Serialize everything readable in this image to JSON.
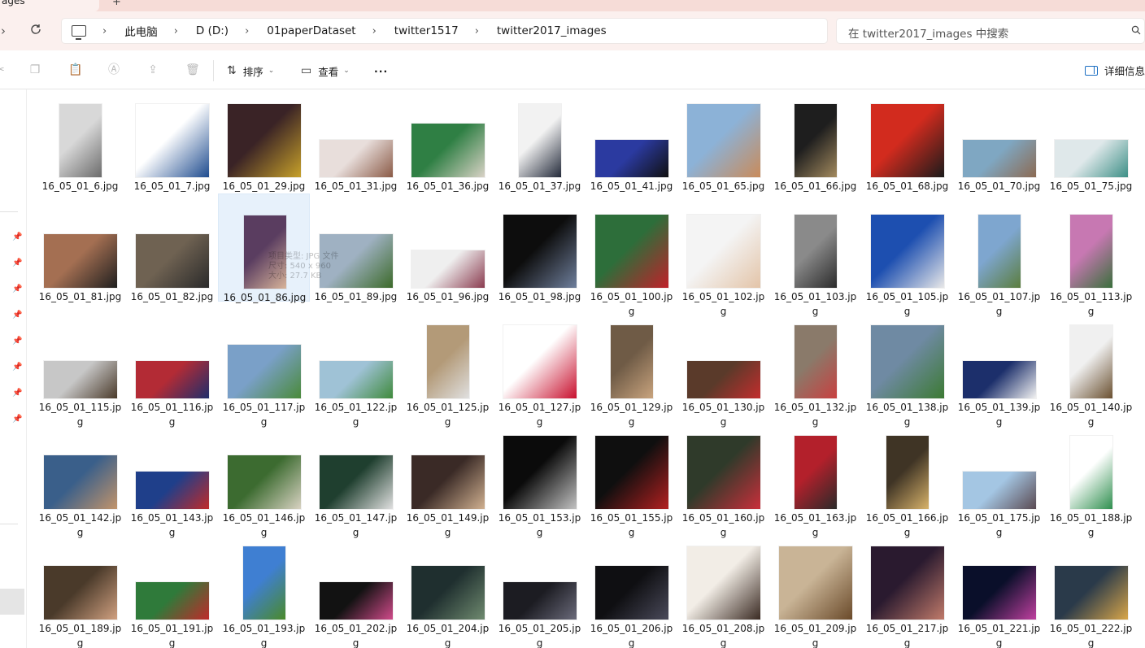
{
  "window": {
    "tab_title": "ages",
    "new_tab_label": "+"
  },
  "addressbar": {
    "crumbs": [
      "此电脑",
      "D (D:)",
      "01paperDataset",
      "twitter1517",
      "twitter2017_images"
    ],
    "separator": "›"
  },
  "search": {
    "placeholder": "在 twitter2017_images 中搜索"
  },
  "toolbar": {
    "sort_label": "排序",
    "view_label": "查看",
    "more_label": "···",
    "details_label": "详细信息"
  },
  "tooltip": {
    "line1": "项目类型: JPG 文件",
    "line2": "尺寸: 540 x 960",
    "line3": "大小: 27.7 KB"
  },
  "colors": {
    "accent": "#1b6ec2",
    "selection": "#e7f1fb",
    "titlebar": "#fbf0ee"
  },
  "files": [
    {
      "name": "16_05_01_6.jpg",
      "thumb": [
        "#d8d8d8",
        "#6b6b6b"
      ],
      "aspect": "portrait"
    },
    {
      "name": "16_05_01_7.jpg",
      "thumb": [
        "#ffffff",
        "#1f4c8f"
      ],
      "aspect": "square"
    },
    {
      "name": "16_05_01_29.jpg",
      "thumb": [
        "#3a2326",
        "#c7a12a"
      ],
      "aspect": "square"
    },
    {
      "name": "16_05_01_31.jpg",
      "thumb": [
        "#e8dedb",
        "#8a5a46"
      ],
      "aspect": "wide"
    },
    {
      "name": "16_05_01_36.jpg",
      "thumb": [
        "#2f7f44",
        "#d9d2c6"
      ],
      "aspect": "landscape"
    },
    {
      "name": "16_05_01_37.jpg",
      "thumb": [
        "#f2f2f2",
        "#232a3a"
      ],
      "aspect": "portrait"
    },
    {
      "name": "16_05_01_41.jpg",
      "thumb": [
        "#2b3aa0",
        "#101010"
      ],
      "aspect": "wide"
    },
    {
      "name": "16_05_01_65.jpg",
      "thumb": [
        "#8cb2d7",
        "#c98b5a"
      ],
      "aspect": "square"
    },
    {
      "name": "16_05_01_66.jpg",
      "thumb": [
        "#1e1e1e",
        "#a38a5e"
      ],
      "aspect": "portrait"
    },
    {
      "name": "16_05_01_68.jpg",
      "thumb": [
        "#d22b1e",
        "#1b1b1b"
      ],
      "aspect": "square"
    },
    {
      "name": "16_05_01_70.jpg",
      "thumb": [
        "#7fa7c2",
        "#8c6a52"
      ],
      "aspect": "wide"
    },
    {
      "name": "16_05_01_75.jpg",
      "thumb": [
        "#dfe8ea",
        "#3d8f86"
      ],
      "aspect": "wide"
    },
    {
      "name": "16_05_01_81.jpg",
      "thumb": [
        "#a46f52",
        "#1f1f1f"
      ],
      "aspect": "landscape"
    },
    {
      "name": "16_05_01_82.jpg",
      "thumb": [
        "#6f6252",
        "#2a2a2a"
      ],
      "aspect": "landscape"
    },
    {
      "name": "16_05_01_86.jpg",
      "thumb": [
        "#5a3d60",
        "#d8b49a"
      ],
      "aspect": "portrait",
      "selected": true
    },
    {
      "name": "16_05_01_89.jpg",
      "thumb": [
        "#9fb1c2",
        "#3c6a2a"
      ],
      "aspect": "landscape"
    },
    {
      "name": "16_05_01_96.jpg",
      "thumb": [
        "#efefef",
        "#8a3b4f"
      ],
      "aspect": "wide"
    },
    {
      "name": "16_05_01_98.jpg",
      "thumb": [
        "#0d0d0d",
        "#6f7f9c"
      ],
      "aspect": "square"
    },
    {
      "name": "16_05_01_100.jpg",
      "thumb": [
        "#2d6e3a",
        "#c0212a"
      ],
      "aspect": "square"
    },
    {
      "name": "16_05_01_102.jpg",
      "thumb": [
        "#f4f4f4",
        "#e3c4a8"
      ],
      "aspect": "square"
    },
    {
      "name": "16_05_01_103.jpg",
      "thumb": [
        "#8a8a8a",
        "#2b2b2b"
      ],
      "aspect": "portrait"
    },
    {
      "name": "16_05_01_105.jpg",
      "thumb": [
        "#1d4fb0",
        "#e8e8e8"
      ],
      "aspect": "square"
    },
    {
      "name": "16_05_01_107.jpg",
      "thumb": [
        "#7ea6cf",
        "#5b7d3e"
      ],
      "aspect": "portrait"
    },
    {
      "name": "16_05_01_113.jpg",
      "thumb": [
        "#c778b2",
        "#3a6f3c"
      ],
      "aspect": "portrait"
    },
    {
      "name": "16_05_01_115.jpg",
      "thumb": [
        "#c7c7c7",
        "#4a3a2a"
      ],
      "aspect": "wide"
    },
    {
      "name": "16_05_01_116.jpg",
      "thumb": [
        "#b32b35",
        "#1f2e6b"
      ],
      "aspect": "wide"
    },
    {
      "name": "16_05_01_117.jpg",
      "thumb": [
        "#7aa0c8",
        "#4a8a3a"
      ],
      "aspect": "landscape"
    },
    {
      "name": "16_05_01_122.jpg",
      "thumb": [
        "#9fc2d6",
        "#3f8a3c"
      ],
      "aspect": "wide"
    },
    {
      "name": "16_05_01_125.jpg",
      "thumb": [
        "#b39a78",
        "#e0e0e0"
      ],
      "aspect": "portrait"
    },
    {
      "name": "16_05_01_127.jpg",
      "thumb": [
        "#ffffff",
        "#c8102e"
      ],
      "aspect": "square"
    },
    {
      "name": "16_05_01_129.jpg",
      "thumb": [
        "#6f5b46",
        "#c9a47e"
      ],
      "aspect": "portrait"
    },
    {
      "name": "16_05_01_130.jpg",
      "thumb": [
        "#5a3a2a",
        "#c32d2d"
      ],
      "aspect": "wide"
    },
    {
      "name": "16_05_01_132.jpg",
      "thumb": [
        "#8a7a6a",
        "#c84040"
      ],
      "aspect": "portrait"
    },
    {
      "name": "16_05_01_138.jpg",
      "thumb": [
        "#6f8aa3",
        "#3c7a33"
      ],
      "aspect": "square"
    },
    {
      "name": "16_05_01_139.jpg",
      "thumb": [
        "#1c2f6b",
        "#f2f2f2"
      ],
      "aspect": "wide"
    },
    {
      "name": "16_05_01_140.jpg",
      "thumb": [
        "#f0f0f0",
        "#6a5030"
      ],
      "aspect": "portrait"
    },
    {
      "name": "16_05_01_142.jpg",
      "thumb": [
        "#3a5f8a",
        "#c2946b"
      ],
      "aspect": "landscape"
    },
    {
      "name": "16_05_01_143.jpg",
      "thumb": [
        "#1f3f8a",
        "#c02a2a"
      ],
      "aspect": "wide"
    },
    {
      "name": "16_05_01_146.jpg",
      "thumb": [
        "#3c6b30",
        "#d8d2c2"
      ],
      "aspect": "landscape"
    },
    {
      "name": "16_05_01_147.jpg",
      "thumb": [
        "#1f3f2f",
        "#e0e0e0"
      ],
      "aspect": "landscape"
    },
    {
      "name": "16_05_01_149.jpg",
      "thumb": [
        "#3a2a26",
        "#d0b090"
      ],
      "aspect": "landscape"
    },
    {
      "name": "16_05_01_153.jpg",
      "thumb": [
        "#0b0b0b",
        "#c2c2c2"
      ],
      "aspect": "square"
    },
    {
      "name": "16_05_01_155.jpg",
      "thumb": [
        "#0f0f0f",
        "#b32020"
      ],
      "aspect": "square"
    },
    {
      "name": "16_05_01_160.jpg",
      "thumb": [
        "#2f3a2a",
        "#c92f3b"
      ],
      "aspect": "square"
    },
    {
      "name": "16_05_01_163.jpg",
      "thumb": [
        "#b3202b",
        "#2a2a2a"
      ],
      "aspect": "portrait"
    },
    {
      "name": "16_05_01_166.jpg",
      "thumb": [
        "#3f3425",
        "#d7b26a"
      ],
      "aspect": "portrait"
    },
    {
      "name": "16_05_01_175.jpg",
      "thumb": [
        "#a4c6e3",
        "#5a4a52"
      ],
      "aspect": "wide"
    },
    {
      "name": "16_05_01_188.jpg",
      "thumb": [
        "#ffffff",
        "#2f8f4f"
      ],
      "aspect": "portrait"
    },
    {
      "name": "16_05_01_189.jpg",
      "thumb": [
        "#4a3a2a",
        "#d0a080"
      ],
      "aspect": "landscape"
    },
    {
      "name": "16_05_01_191.jpg",
      "thumb": [
        "#2f7a3a",
        "#c02a2a"
      ],
      "aspect": "wide"
    },
    {
      "name": "16_05_01_193.jpg",
      "thumb": [
        "#3f7fd2",
        "#4a8a2a"
      ],
      "aspect": "portrait"
    },
    {
      "name": "16_05_01_202.jpg",
      "thumb": [
        "#121212",
        "#d04a8a"
      ],
      "aspect": "wide"
    },
    {
      "name": "16_05_01_204.jpg",
      "thumb": [
        "#1f2f2f",
        "#6f8a6f"
      ],
      "aspect": "landscape"
    },
    {
      "name": "16_05_01_205.jpg",
      "thumb": [
        "#1c1c22",
        "#6a6a7a"
      ],
      "aspect": "wide"
    },
    {
      "name": "16_05_01_206.jpg",
      "thumb": [
        "#0f0f12",
        "#4a4a5a"
      ],
      "aspect": "landscape"
    },
    {
      "name": "16_05_01_208.jpg",
      "thumb": [
        "#f2ede6",
        "#3a2a22"
      ],
      "aspect": "square"
    },
    {
      "name": "16_05_01_209.jpg",
      "thumb": [
        "#c9b496",
        "#6a4a2a"
      ],
      "aspect": "square"
    },
    {
      "name": "16_05_01_217.jpg",
      "thumb": [
        "#2a1a2f",
        "#c07a6a"
      ],
      "aspect": "square"
    },
    {
      "name": "16_05_01_221.jpg",
      "thumb": [
        "#0a0f2a",
        "#c040a0"
      ],
      "aspect": "landscape"
    },
    {
      "name": "16_05_01_222.jpg",
      "thumb": [
        "#2a3a4a",
        "#d8a64a"
      ],
      "aspect": "landscape"
    }
  ]
}
